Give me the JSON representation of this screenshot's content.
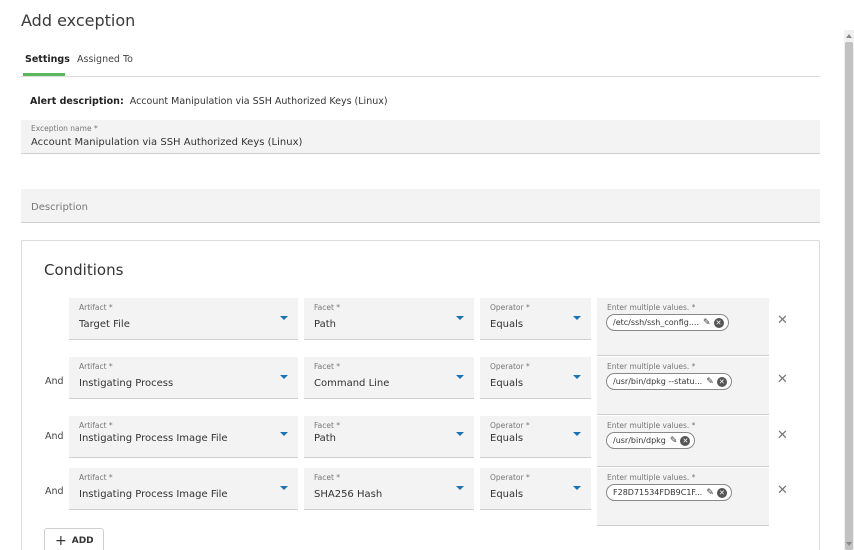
{
  "page": {
    "title": "Add exception"
  },
  "tabs": [
    {
      "label": "Settings",
      "active": true
    },
    {
      "label": "Assigned To",
      "active": false
    }
  ],
  "alert": {
    "label": "Alert description:",
    "value": "Account Manipulation via SSH Authorized Keys (Linux)"
  },
  "exception_name": {
    "label": "Exception name *",
    "value": "Account Manipulation via SSH Authorized Keys (Linux)"
  },
  "description": {
    "placeholder": "Description"
  },
  "conditions": {
    "title": "Conditions",
    "and_label": "And",
    "artifact_label": "Artifact *",
    "facet_label": "Facet *",
    "operator_label": "Operator *",
    "values_label": "Enter multiple values. *",
    "rows": [
      {
        "artifact": "Target File",
        "facet": "Path",
        "operator": "Equals",
        "value": "/etc/ssh/ssh_config...."
      },
      {
        "artifact": "Instigating Process",
        "facet": "Command Line",
        "operator": "Equals",
        "value": "/usr/bin/dpkg --statu..."
      },
      {
        "artifact": "Instigating Process Image File",
        "facet": "Path",
        "operator": "Equals",
        "value": "/usr/bin/dpkg"
      },
      {
        "artifact": "Instigating Process Image File",
        "facet": "SHA256 Hash",
        "operator": "Equals",
        "value": "F28D71534FDB9C1F..."
      }
    ],
    "add_label": "ADD"
  },
  "icons": {
    "remove": "close-icon",
    "edit": "pencil-icon",
    "clear": "x-circle-icon",
    "dropdown": "caret-down-icon",
    "add": "plus-icon"
  },
  "colors": {
    "active_tab_underline": "#5cb85c",
    "caret": "#1a73b5"
  }
}
